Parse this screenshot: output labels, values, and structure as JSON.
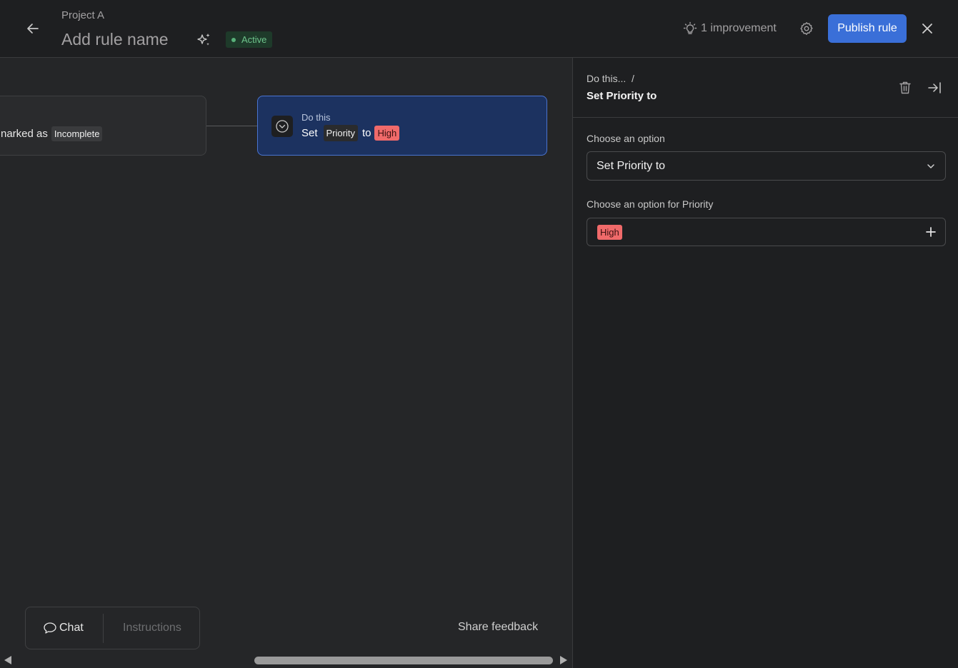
{
  "header": {
    "project": "Project A",
    "rule_name": "Add rule name",
    "status": "Active",
    "improvement": "1 improvement",
    "publish_label": "Publish rule"
  },
  "canvas": {
    "trigger": {
      "prefix": "narked as",
      "value": "Incomplete"
    },
    "action": {
      "label": "Do this",
      "verb": "Set",
      "field": "Priority",
      "joiner": "to",
      "value": "High"
    },
    "tabs": {
      "chat": "Chat",
      "instructions": "Instructions"
    },
    "share_feedback": "Share feedback"
  },
  "panel": {
    "breadcrumb": "Do this...  /",
    "title": "Set Priority to",
    "option_label": "Choose an option",
    "option_value": "Set Priority to",
    "priority_label": "Choose an option for Priority",
    "priority_value": "High"
  },
  "colors": {
    "accent": "#3a6fd8",
    "high": "#f06a6a",
    "active": "#6ec58c",
    "action_card": "#1c3260"
  },
  "icons": [
    "arrow-left-icon",
    "sparkle-icon",
    "lightbulb-icon",
    "gear-icon",
    "close-icon",
    "chevron-circle-icon",
    "chat-bubble-icon",
    "trash-icon",
    "collapse-right-icon",
    "chevron-down-icon",
    "plus-icon",
    "triangle-left-icon",
    "triangle-right-icon"
  ]
}
